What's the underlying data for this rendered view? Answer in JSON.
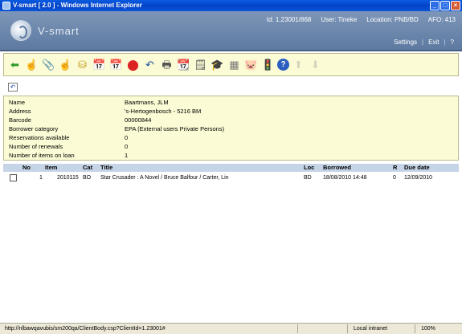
{
  "window": {
    "title": "V-smart [ 2.0 ] - Windows Internet Explorer",
    "buttons": [
      "_",
      "□",
      "×"
    ]
  },
  "header": {
    "brand": "V-smart",
    "session": {
      "id": "Id: 1.23001/868",
      "user": "User: Tineke",
      "location": "Location: PNB/BD",
      "afo": "AFO: 413"
    },
    "links": {
      "settings": "Settings",
      "exit": "Exit",
      "help": "?"
    }
  },
  "toolbar": {
    "icons": [
      {
        "name": "back-arrow-icon",
        "glyph": "⬅",
        "color": "#2e9a2e",
        "enabled": true
      },
      {
        "name": "hand-pointer-icon",
        "glyph": "☝",
        "color": "#8a6a2a",
        "enabled": true
      },
      {
        "name": "paperclip-icon",
        "glyph": "📎",
        "color": "#808080",
        "enabled": true
      },
      {
        "name": "hand-select-icon",
        "glyph": "☝",
        "color": "#8a6a2a",
        "enabled": true
      },
      {
        "name": "coins-icon",
        "glyph": "⛁",
        "color": "#c69b1c",
        "enabled": true
      },
      {
        "name": "calendar-31-icon",
        "glyph": "📅",
        "color": "#2050a0",
        "enabled": true
      },
      {
        "name": "calendar-31-plus-icon",
        "glyph": "📅",
        "color": "#2050a0",
        "enabled": true
      },
      {
        "name": "stop-icon",
        "glyph": "⬤",
        "color": "#d22",
        "enabled": true
      },
      {
        "name": "undo-arrow-icon",
        "glyph": "↶",
        "color": "#2050a0",
        "enabled": true
      },
      {
        "name": "printer-icon",
        "glyph": "🖶",
        "color": "#555",
        "enabled": true
      },
      {
        "name": "calendar-edit-icon",
        "glyph": "📆",
        "color": "#2050a0",
        "enabled": true
      },
      {
        "name": "list-search-icon",
        "glyph": "🗒",
        "color": "#555",
        "enabled": true
      },
      {
        "name": "graduation-cap-icon",
        "glyph": "🎓",
        "color": "#2050a0",
        "enabled": true
      },
      {
        "name": "grid-icon",
        "glyph": "▦",
        "color": "#777",
        "enabled": true
      },
      {
        "name": "piggy-bank-icon",
        "glyph": "🐷",
        "color": "#e08080",
        "enabled": true
      },
      {
        "name": "traffic-light-icon",
        "glyph": "🚦",
        "color": "#c8a000",
        "enabled": true
      },
      {
        "name": "help-icon",
        "glyph": "?",
        "color": "#ffffff",
        "enabled": true
      },
      {
        "name": "up-arrow-icon",
        "glyph": "⬆",
        "color": "#909090",
        "enabled": false
      },
      {
        "name": "down-arrow-icon",
        "glyph": "⬇",
        "color": "#909090",
        "enabled": false
      }
    ]
  },
  "undo_button": "↶",
  "borrower": [
    {
      "label": "Name",
      "value": "Baartmans, JLM"
    },
    {
      "label": "Address",
      "value": "'s-Hertogenbosch - 5216 BM"
    },
    {
      "label": "Barcode",
      "value": "00000844"
    },
    {
      "label": "Borrower category",
      "value": "EPA (External users Private Persons)"
    },
    {
      "label": "Reservations available",
      "value": "0"
    },
    {
      "label": "Number of renewals",
      "value": "0"
    },
    {
      "label": "Number of items on loan",
      "value": "1"
    }
  ],
  "loans": {
    "columns": {
      "no": "No",
      "item": "Item",
      "cat": "Cat",
      "title": "Title",
      "loc": "Loc",
      "borrowed": "Borrowed",
      "r": "R",
      "due": "Due date"
    },
    "rows": [
      {
        "no": "1",
        "item": "2010115",
        "cat": "BO",
        "title": "Star Crusader : A Novel / Bruce Balfour / Carter, Lin",
        "loc": "BD",
        "borrowed": "18/08/2010 14:48",
        "r": "0",
        "due": "12/09/2010"
      }
    ]
  },
  "statusbar": {
    "url": "http://nlbawqavubis/sm200qa/ClientBody.csp?ClientId=1.23001#",
    "zone": "Local intranet",
    "zoom": "100%"
  }
}
